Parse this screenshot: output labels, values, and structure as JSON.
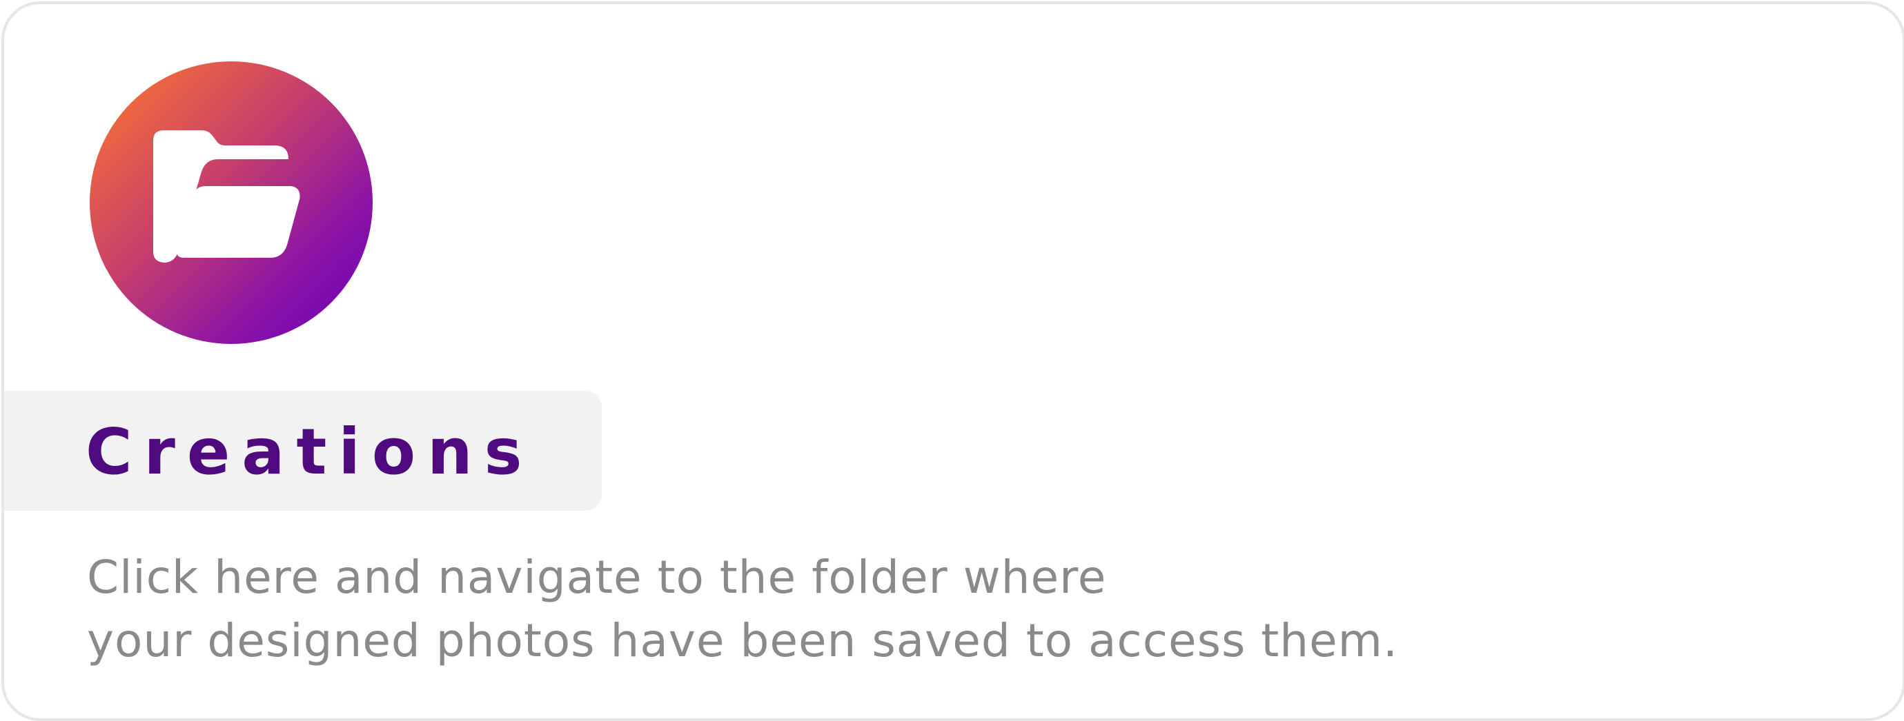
{
  "card": {
    "title": "Creations",
    "description_line1": "Click here and navigate to the folder where",
    "description_line2": "your designed photos have been saved to access them.",
    "icon": "folder-icon"
  },
  "colors": {
    "title": "#4f0a80",
    "description": "#8a8a8a",
    "icon_gradient_start": "#ff7a2a",
    "icon_gradient_end": "#6a00b8",
    "title_background": "#f2f2f2",
    "card_border": "#e6e6e6"
  }
}
